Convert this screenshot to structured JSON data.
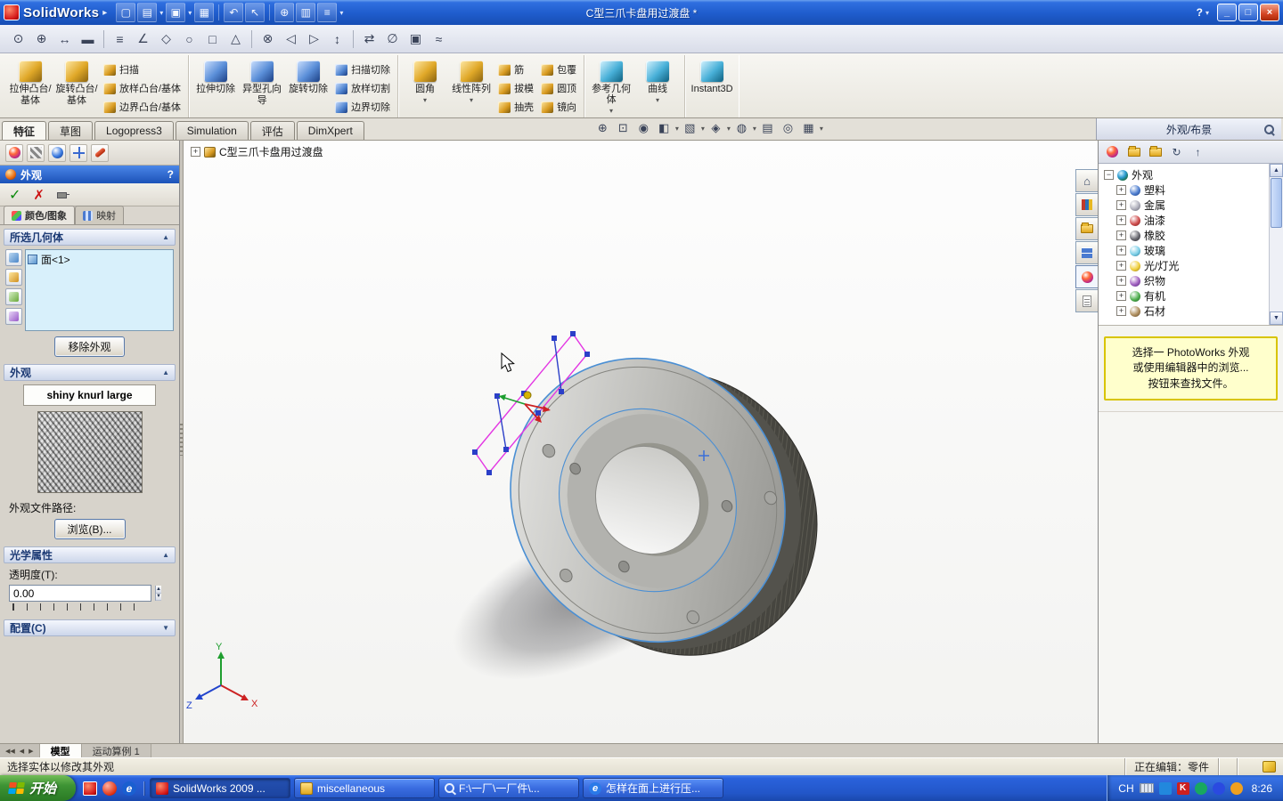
{
  "colors": {
    "accent_blue": "#1c52b8",
    "selection_box": "#d8f0fb",
    "note_yellow": "#ffffcc",
    "start_green": "#3d9334",
    "taskbar_blue": "#2a62dc"
  },
  "icons": {
    "menu_caret": "▸",
    "dropdown": "▾",
    "minimize": "_",
    "restore": "□",
    "close": "×",
    "help": "?",
    "plus": "+",
    "minus": "−",
    "check": "✓",
    "cancel": "✗",
    "chevron_up": "▲",
    "chevron_down": "▼",
    "spin_up": "▲",
    "spin_down": "▼",
    "nav_first": "◀◀",
    "nav_prev": "◀",
    "nav_next": "▶",
    "home": "⌂",
    "refresh": "↻",
    "up_arrow": "↑",
    "std": [
      "▢",
      "▤",
      "▣",
      "▦",
      "↶",
      "↖",
      "⊕",
      "▥",
      "≡"
    ],
    "sketch": [
      "⊙",
      "⊕",
      "↔",
      "▬",
      "≡",
      "∠",
      "◇",
      "○",
      "□",
      "△",
      "⊗",
      "◁",
      "▷",
      "↕",
      "⇄",
      "∅",
      "▣",
      "≈"
    ],
    "view": [
      "⊕",
      "⊡",
      "◉",
      "◧",
      "▧",
      "◈",
      "◍",
      "▤",
      "◎",
      "▦"
    ]
  },
  "titlebar": {
    "app": "SolidWorks",
    "title": "C型三爪卡盘用过渡盘 *"
  },
  "command_tabs": [
    "特征",
    "草图",
    "Logopress3",
    "Simulation",
    "评估",
    "DimXpert"
  ],
  "ribbon": {
    "large1": [
      "拉伸凸台/基体",
      "旋转凸台/基体"
    ],
    "stack1": [
      "扫描",
      "放样凸台/基体",
      "边界凸台/基体"
    ],
    "large2": [
      "拉伸切除",
      "异型孔向导",
      "旋转切除"
    ],
    "stack2": [
      "扫描切除",
      "放样切割",
      "边界切除"
    ],
    "large3": [
      "圆角",
      "线性阵列"
    ],
    "stack3": [
      "筋",
      "拔模",
      "抽壳"
    ],
    "stack4": [
      "包覆",
      "圆顶",
      "镜向"
    ],
    "large4": [
      "参考几何体",
      "曲线"
    ],
    "instant3d": "Instant3D"
  },
  "property_manager": {
    "title": "外观",
    "tab_color": "颜色/图象",
    "tab_mapping": "映射",
    "selected_geometry": {
      "header": "所选几何体",
      "item": "面<1>",
      "remove_button": "移除外观"
    },
    "appearance": {
      "header": "外观",
      "name": "shiny knurl large",
      "path_label": "外观文件路径:",
      "browse_button": "浏览(B)..."
    },
    "optical": {
      "header": "光学属性",
      "transparency_label": "透明度(T):",
      "transparency_value": "0.00"
    },
    "config_header": "配置(C)"
  },
  "viewport": {
    "breadcrumb": "C型三爪卡盘用过渡盘",
    "triad": {
      "x": "X",
      "y": "Y",
      "z": "Z"
    }
  },
  "task_pane": {
    "header": "外观/布景",
    "root": "外观",
    "items": [
      "塑料",
      "金属",
      "油漆",
      "橡胶",
      "玻璃",
      "光/灯光",
      "织物",
      "有机",
      "石材"
    ],
    "note_lines": [
      "选择一 PhotoWorks 外观",
      "或使用编辑器中的浏览...",
      "按钮来查找文件。"
    ]
  },
  "model_tabs": {
    "model": "模型",
    "motion": "运动算例 1"
  },
  "statusbar": {
    "message": "选择实体以修改其外观",
    "editing": "正在编辑：零件"
  },
  "taskbar": {
    "start": "开始",
    "buttons": [
      "SolidWorks 2009 ...",
      "miscellaneous",
      "F:\\一厂\\一厂件\\...",
      "怎样在面上进行压..."
    ],
    "tray_lang": "CH",
    "time": "8:26"
  }
}
